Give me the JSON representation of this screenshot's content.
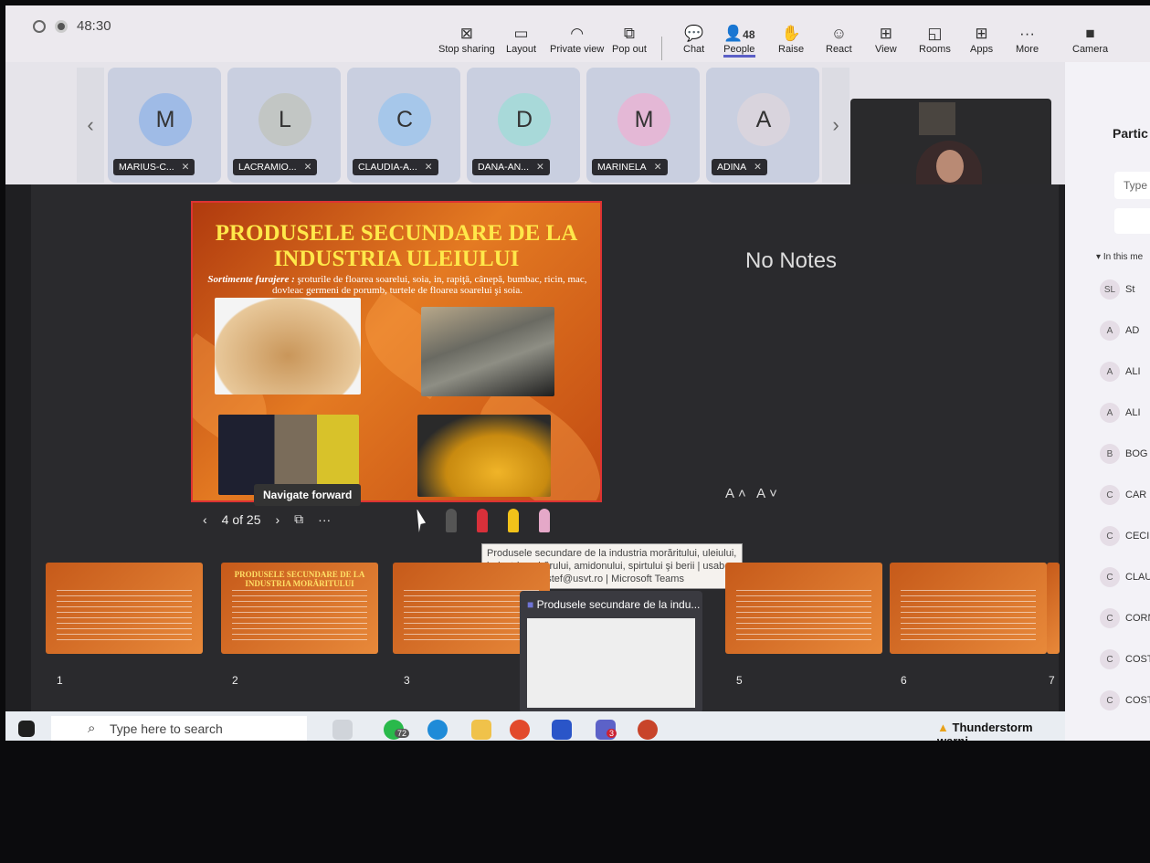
{
  "timer": "48:30",
  "toolbar": {
    "stop_sharing": "Stop sharing",
    "layout": "Layout",
    "private_view": "Private view",
    "pop_out": "Pop out",
    "chat": "Chat",
    "people": "People",
    "people_count": "48",
    "raise": "Raise",
    "react": "React",
    "view": "View",
    "rooms": "Rooms",
    "apps": "Apps",
    "more": "More",
    "camera": "Camera"
  },
  "participants": [
    {
      "initial": "M",
      "name": "MARIUS-C...",
      "color": "#9fbbe6"
    },
    {
      "initial": "L",
      "name": "LACRAMIO...",
      "color": "#c2c6c4"
    },
    {
      "initial": "C",
      "name": "CLAUDIA-A...",
      "color": "#a6c7ea"
    },
    {
      "initial": "D",
      "name": "DANA-AN...",
      "color": "#a8d9d9"
    },
    {
      "initial": "M",
      "name": "MARINELA",
      "color": "#e4b8d6"
    },
    {
      "initial": "A",
      "name": "ADINA",
      "color": "#d9d4dd"
    }
  ],
  "right_panel": {
    "title": "Partic",
    "search_placeholder": "Type",
    "section": "In this me",
    "people": [
      {
        "initials": "SL",
        "name": "St"
      },
      {
        "initials": "A",
        "name": "AD"
      },
      {
        "initials": "A",
        "name": "ALI"
      },
      {
        "initials": "A",
        "name": "ALI"
      },
      {
        "initials": "B",
        "name": "BOG"
      },
      {
        "initials": "C",
        "name": "CAR"
      },
      {
        "initials": "C",
        "name": "CECI"
      },
      {
        "initials": "C",
        "name": "CLAU"
      },
      {
        "initials": "C",
        "name": "CORN"
      },
      {
        "initials": "C",
        "name": "COSTE"
      },
      {
        "initials": "C",
        "name": "COSTIN"
      }
    ]
  },
  "slide": {
    "title": "PRODUSELE SECUNDARE DE LA INDUSTRIA ULEIULUI",
    "subtitle_label": "Sortimente furajere :",
    "subtitle_text": "şroturile de floarea soarelui, soia, in, rapiţă, cânepă, bumbac, ricin, mac, dovleac germeni de porumb, turtele de floarea soarelui şi soia."
  },
  "notes": "No Notes",
  "font_controls": "A˄ A˅",
  "navigation": {
    "counter": "4 of 25",
    "tooltip": "Navigate forward"
  },
  "app_tooltip": "Produsele secundare de la industria morăritului, uleiului, industria zahărului, amidonului, spirtului şi berii | usab-tm.ro | laviniastef@usvt.ro | Microsoft Teams",
  "thumbnails": [
    {
      "num": "1",
      "title": ""
    },
    {
      "num": "2",
      "title": "PRODUSELE SECUNDARE DE LA INDUSTRIA MORĂRITULUI"
    },
    {
      "num": "3",
      "title": ""
    },
    {
      "num": "5",
      "title": ""
    },
    {
      "num": "6",
      "title": ""
    },
    {
      "num": "7",
      "title": ""
    }
  ],
  "preview_title": "Produsele secundare de la indu...",
  "taskbar": {
    "search_placeholder": "Type here to search",
    "whatsapp_badge": "72",
    "teams_badge": "3",
    "weather": "Thunderstorm warni..."
  }
}
